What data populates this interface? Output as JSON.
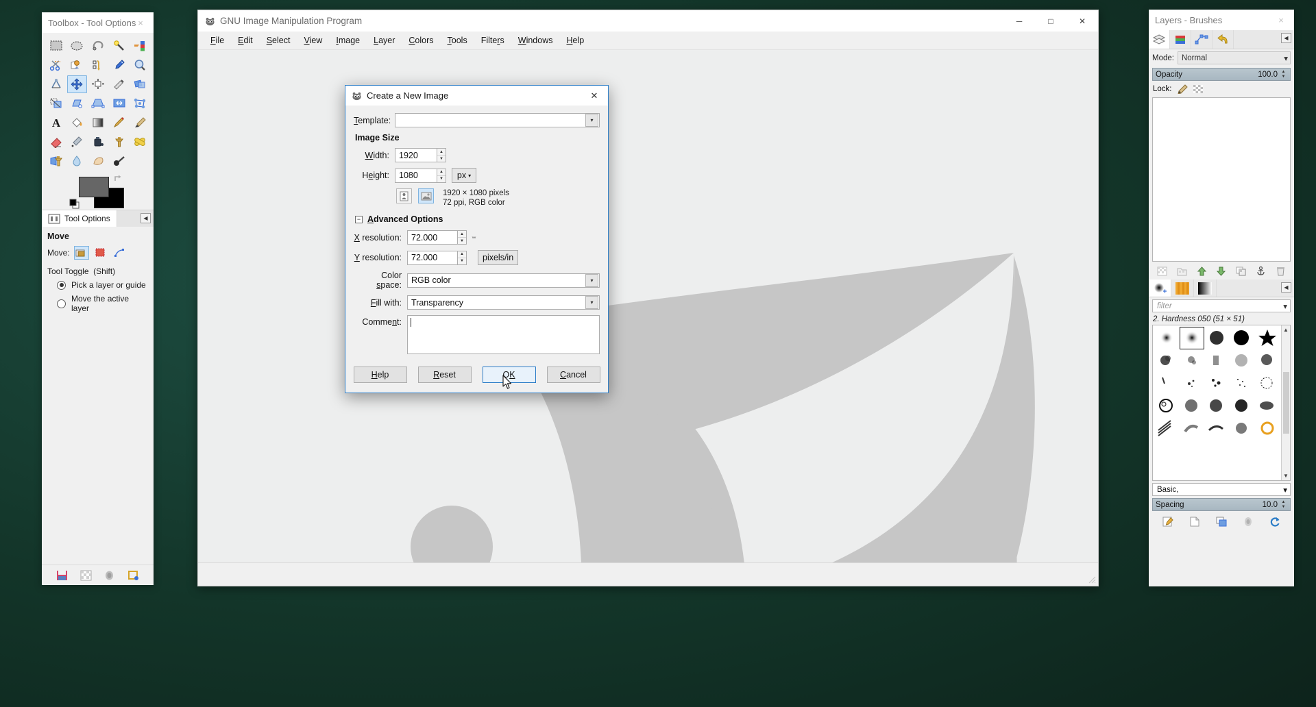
{
  "desktop": {
    "background_color": "#164034"
  },
  "toolbox": {
    "title": "Toolbox - Tool Options",
    "close_label": "×",
    "tools": [
      {
        "name": "rect-select-tool",
        "label": "Rectangle Select"
      },
      {
        "name": "ellipse-select-tool",
        "label": "Ellipse Select"
      },
      {
        "name": "free-select-tool",
        "label": "Free Select"
      },
      {
        "name": "fuzzy-select-tool",
        "label": "Fuzzy Select"
      },
      {
        "name": "select-by-color-tool",
        "label": "Select by Color"
      },
      {
        "name": "scissors-select-tool",
        "label": "Scissors Select"
      },
      {
        "name": "foreground-select-tool",
        "label": "Foreground Select"
      },
      {
        "name": "paths-tool",
        "label": "Paths"
      },
      {
        "name": "color-picker-tool",
        "label": "Color Picker"
      },
      {
        "name": "zoom-tool",
        "label": "Zoom"
      },
      {
        "name": "measure-tool",
        "label": "Measure"
      },
      {
        "name": "move-tool",
        "label": "Move"
      },
      {
        "name": "alignment-tool",
        "label": "Alignment"
      },
      {
        "name": "crop-tool",
        "label": "Crop"
      },
      {
        "name": "rotate-tool",
        "label": "Rotate"
      },
      {
        "name": "scale-tool",
        "label": "Scale"
      },
      {
        "name": "shear-tool",
        "label": "Shear"
      },
      {
        "name": "perspective-tool",
        "label": "Perspective"
      },
      {
        "name": "flip-tool",
        "label": "Flip"
      },
      {
        "name": "cage-transform-tool",
        "label": "Cage Transform"
      },
      {
        "name": "text-tool",
        "label": "Text"
      },
      {
        "name": "bucket-fill-tool",
        "label": "Bucket Fill"
      },
      {
        "name": "gradient-tool",
        "label": "Gradient"
      },
      {
        "name": "pencil-tool",
        "label": "Pencil"
      },
      {
        "name": "paintbrush-tool",
        "label": "Paintbrush"
      },
      {
        "name": "eraser-tool",
        "label": "Eraser"
      },
      {
        "name": "airbrush-tool",
        "label": "Airbrush"
      },
      {
        "name": "ink-tool",
        "label": "Ink"
      },
      {
        "name": "clone-tool",
        "label": "Clone"
      },
      {
        "name": "heal-tool",
        "label": "Heal"
      },
      {
        "name": "perspective-clone-tool",
        "label": "Perspective Clone"
      },
      {
        "name": "blur-sharpen-tool",
        "label": "Blur / Sharpen"
      },
      {
        "name": "smudge-tool",
        "label": "Smudge"
      },
      {
        "name": "dodge-burn-tool",
        "label": "Dodge / Burn"
      }
    ],
    "selected_tool_index": 11,
    "colors": {
      "foreground": "#666666",
      "background": "#000000"
    },
    "footer_icons": [
      "save-icon",
      "checker-image-icon",
      "brush-icon",
      "restore-icon"
    ]
  },
  "tool_options": {
    "tab_label": "Tool Options",
    "tool_title": "Move",
    "move_label": "Move:",
    "move_modes": [
      "move-layer-mode",
      "move-selection-mode",
      "move-path-mode"
    ],
    "selected_move_mode": 0,
    "tool_toggle_label": "Tool Toggle",
    "tool_toggle_shortcut": "(Shift)",
    "radios": [
      {
        "label": "Pick a layer or guide",
        "selected": true
      },
      {
        "label": "Move the active layer",
        "selected": false
      }
    ]
  },
  "main_window": {
    "title": "GNU Image Manipulation Program",
    "menu": [
      {
        "text": "File",
        "mnemonic": "F"
      },
      {
        "text": "Edit",
        "mnemonic": "E"
      },
      {
        "text": "Select",
        "mnemonic": "S"
      },
      {
        "text": "View",
        "mnemonic": "V"
      },
      {
        "text": "Image",
        "mnemonic": "I"
      },
      {
        "text": "Layer",
        "mnemonic": "L"
      },
      {
        "text": "Colors",
        "mnemonic": "C"
      },
      {
        "text": "Tools",
        "mnemonic": "T"
      },
      {
        "text": "Filters",
        "mnemonic": "r"
      },
      {
        "text": "Windows",
        "mnemonic": "W"
      },
      {
        "text": "Help",
        "mnemonic": "H"
      }
    ],
    "window_controls": {
      "minimize": "─",
      "maximize": "□",
      "close": "✕"
    }
  },
  "right_dock": {
    "title": "Layers - Brushes",
    "close_label": "×",
    "layer_tabs": [
      "layers-icon",
      "channels-icon",
      "paths-icon",
      "undo-history-icon"
    ],
    "active_layer_tab": 0,
    "mode_label": "Mode:",
    "mode_value": "Normal",
    "opacity_label": "Opacity",
    "opacity_value": "100.0",
    "lock_label": "Lock:",
    "lock_icons": [
      "lock-pixels-icon",
      "lock-alpha-icon"
    ],
    "layer_toolbar_icons": [
      "new-layer-icon",
      "new-layer-group-icon",
      "raise-layer-icon",
      "lower-layer-icon",
      "duplicate-layer-icon",
      "anchor-layer-icon",
      "delete-layer-icon"
    ],
    "brush_tabs": [
      "brushes-icon",
      "patterns-icon",
      "gradients-icon"
    ],
    "active_brush_tab": 0,
    "filter_placeholder": "filter",
    "selected_brush_name": "2. Hardness 050 (51 × 51)",
    "brush_list_value": "Basic,",
    "spacing_label": "Spacing",
    "spacing_value": "10.0",
    "brush_footer_icons": [
      "edit-brush-icon",
      "new-brush-icon",
      "duplicate-brush-icon",
      "delete-brush-icon",
      "refresh-brushes-icon"
    ]
  },
  "new_image_dialog": {
    "title": "Create a New Image",
    "close_label": "✕",
    "template_label": "Template:",
    "template_value": "",
    "image_size_heading": "Image Size",
    "width_label": "Width:",
    "width_value": "1920",
    "height_label": "Height:",
    "height_value": "1080",
    "unit_value": "px",
    "orientation": {
      "portrait_name": "portrait-orientation-button",
      "landscape_name": "landscape-orientation-button",
      "selected": "landscape"
    },
    "summary_line1": "1920 × 1080 pixels",
    "summary_line2": "72 ppi, RGB color",
    "advanced_options_label": "Advanced Options",
    "advanced_expanded": true,
    "x_resolution_label": "X resolution:",
    "x_resolution_value": "72.000",
    "y_resolution_label": "Y resolution:",
    "y_resolution_value": "72.000",
    "resolution_unit": "pixels/in",
    "color_space_label": "Color space:",
    "color_space_value": "RGB color",
    "fill_with_label": "Fill with:",
    "fill_with_value": "Transparency",
    "comment_label": "Comment:",
    "comment_value": "",
    "buttons": [
      {
        "label": "Help",
        "name": "help-button",
        "default": false
      },
      {
        "label": "Reset",
        "name": "reset-button",
        "default": false
      },
      {
        "label": "OK",
        "name": "ok-button",
        "default": true
      },
      {
        "label": "Cancel",
        "name": "cancel-button",
        "default": false
      }
    ],
    "accent_color": "#2a7cc7"
  }
}
